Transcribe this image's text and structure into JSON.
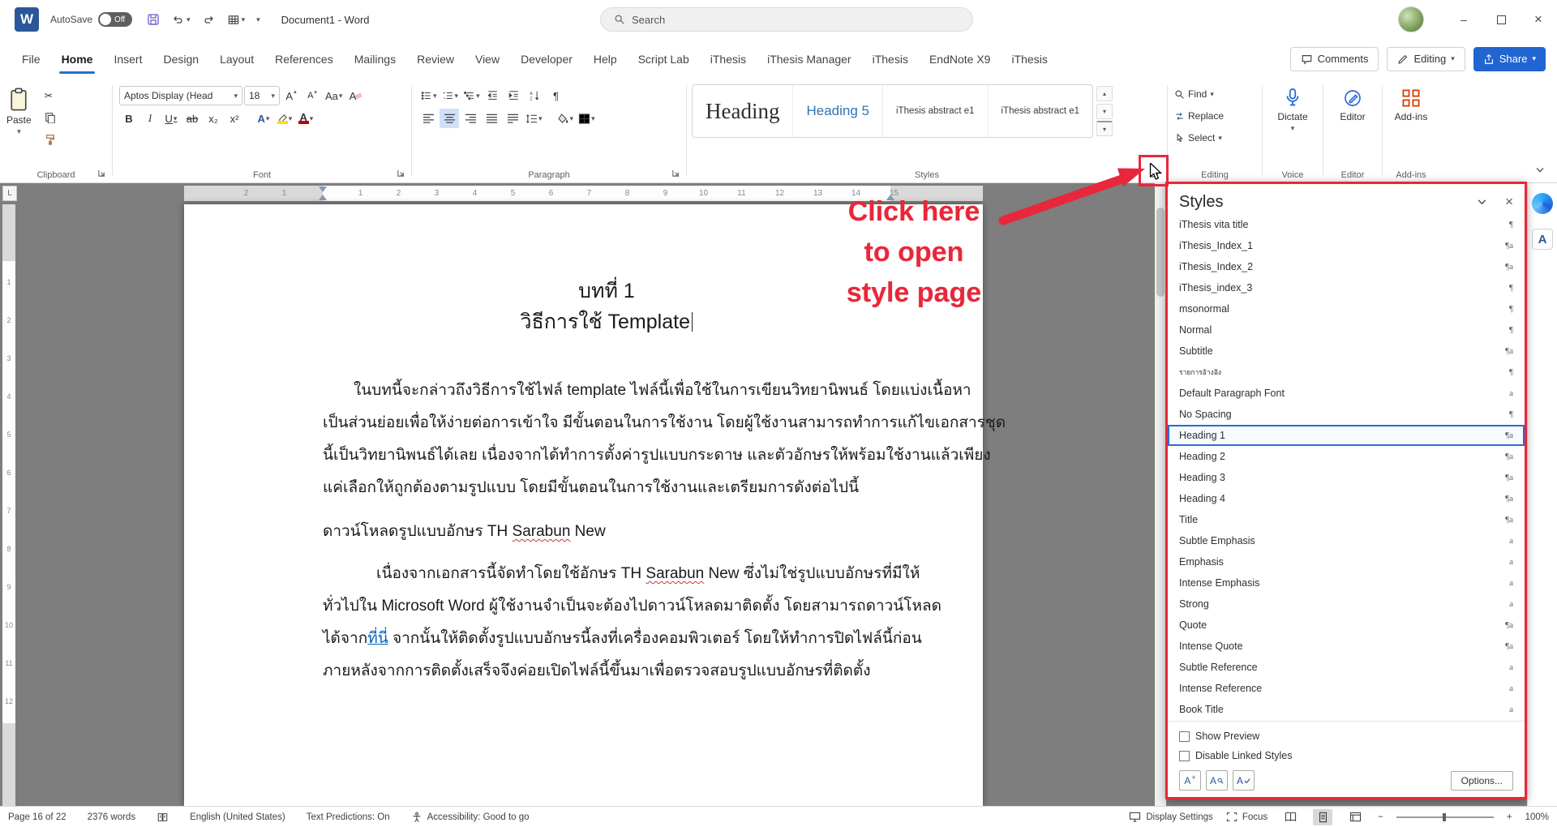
{
  "icons": {
    "chevron_down": "▾",
    "chevron_up": "▴",
    "pilcrow": "¶",
    "scissors": "✂",
    "close_x": "×",
    "minimize": "–",
    "bold": "B",
    "italic": "I",
    "underline": "U",
    "strike": "ab",
    "subscript": "x₂",
    "superscript": "x²",
    "case_aa": "Aa",
    "letter_a": "A",
    "plus": "+",
    "minus": "−",
    "ruler_tab": "L",
    "logo": "W"
  },
  "titlebar": {
    "logo": "W",
    "autosave_label": "AutoSave",
    "autosave_state": "Off",
    "doc_title": "Document1 - Word",
    "search_label": "Search"
  },
  "tabs": [
    "File",
    "Home",
    "Insert",
    "Design",
    "Layout",
    "References",
    "Mailings",
    "Review",
    "View",
    "Developer",
    "Help",
    "Script Lab",
    "iThesis",
    "iThesis Manager",
    "iThesis",
    "EndNote X9",
    "iThesis"
  ],
  "tab_actions": {
    "comments": "Comments",
    "editing": "Editing",
    "share": "Share"
  },
  "ribbon": {
    "font_name": "Aptos Display (Head",
    "font_size": "18",
    "paste": "Paste",
    "dictate": "Dictate",
    "editor": "Editor",
    "addins": "Add-ins",
    "find": "Find",
    "replace": "Replace",
    "select": "Select",
    "gallery": {
      "item1": "Heading",
      "item2": "Heading 5",
      "item3": "iThesis abstract e1",
      "item4": "iThesis abstract e1"
    },
    "labels": {
      "clipboard": "Clipboard",
      "font": "Font",
      "paragraph": "Paragraph",
      "styles": "Styles",
      "editing": "Editing",
      "voice": "Voice",
      "editor": "Editor",
      "addins": "Add-ins"
    }
  },
  "annotation": {
    "line1": "Click here",
    "line2": "to open",
    "line3": "style page"
  },
  "ruler": {
    "left_numbers": [
      "2",
      "1"
    ],
    "main_numbers": [
      "1",
      "2",
      "3",
      "4",
      "5",
      "6",
      "7",
      "8",
      "9",
      "10",
      "11",
      "12",
      "13",
      "14",
      "15"
    ],
    "v_numbers": [
      "1",
      "2",
      "3",
      "4",
      "5",
      "6",
      "7",
      "8",
      "9",
      "10",
      "11",
      "12"
    ]
  },
  "doc": {
    "h1": "บทที่ 1",
    "h2_thai": "วิธีการใช้ ",
    "h2_latin": "Template",
    "p1_l1": "ในบทนี้จะกล่าวถึงวิธีการใช้ไฟล์ template ไฟล์นี้เพื่อใช้ในการเขียนวิทยานิพนธ์ โดยแบ่งเนื้อหา",
    "p1_l2": "เป็นส่วนย่อยเพื่อให้ง่ายต่อการเข้าใจ มีขั้นตอนในการใช้งาน โดยผู้ใช้งานสามารถทำการแก้ไขเอกสารชุด",
    "p1_l3": "นี้เป็นวิทยานิพนธ์ได้เลย เนื่องจากได้ทำการตั้งค่ารูปแบบกระดาษ และตัวอักษรให้พร้อมใช้งานแล้วเพียง",
    "p1_l4": "แค่เลือกให้ถูกต้องตามรูปแบบ โดยมีขั้นตอนในการใช้งานและเตรียมการดังต่อไปนี้",
    "sub_a": "ดาวน์โหลดรูปแบบอักษร TH ",
    "sub_b": "Sarabun",
    "sub_c": " New",
    "p2_l1a": "เนื่องจากเอกสารนี้จัดทำโดยใช้อักษร TH ",
    "p2_l1b": "Sarabun",
    "p2_l1c": " New ซึ่งไม่ใช่รูปแบบอักษรที่มีให้",
    "p2_l2": "ทั่วไปใน Microsoft Word ผู้ใช้งานจำเป็นจะต้องไปดาวน์โหลดมาติดตั้ง โดยสามารถดาวน์โหลด",
    "p2_l3a": "ได้จาก",
    "p2_l3_link": "ที่นี่",
    "p2_l3b": " จากนั้นให้ติดตั้งรูปแบบอักษรนี้ลงที่เครื่องคอมพิวเตอร์ โดยให้ทำการปิดไฟล์นี้ก่อน",
    "p2_l4": "ภายหลังจากการติดตั้งเสร็จจึงค่อยเปิดไฟล์นี้ขึ้นมาเพื่อตรวจสอบรูปแบบอักษรที่ติดตั้ง"
  },
  "styles_pane": {
    "title": "Styles",
    "items": [
      {
        "name": "iThesis vita title",
        "mark": "¶"
      },
      {
        "name": "iThesis_Index_1",
        "mark": "¶a"
      },
      {
        "name": "iThesis_Index_2",
        "mark": "¶a"
      },
      {
        "name": "iThesis_index_3",
        "mark": "¶"
      },
      {
        "name": "msonormal",
        "mark": "¶"
      },
      {
        "name": "Normal",
        "mark": "¶"
      },
      {
        "name": "Subtitle",
        "mark": "¶a"
      },
      {
        "name": "รายการอ้างอิง",
        "mark": "¶"
      },
      {
        "name": "Default Paragraph Font",
        "mark": "a"
      },
      {
        "name": "No Spacing",
        "mark": "¶"
      },
      {
        "name": "Heading 1",
        "mark": "¶a"
      },
      {
        "name": "Heading 2",
        "mark": "¶a"
      },
      {
        "name": "Heading 3",
        "mark": "¶a"
      },
      {
        "name": "Heading 4",
        "mark": "¶a"
      },
      {
        "name": "Title",
        "mark": "¶a"
      },
      {
        "name": "Subtle Emphasis",
        "mark": "a"
      },
      {
        "name": "Emphasis",
        "mark": "a"
      },
      {
        "name": "Intense Emphasis",
        "mark": "a"
      },
      {
        "name": "Strong",
        "mark": "a"
      },
      {
        "name": "Quote",
        "mark": "¶a"
      },
      {
        "name": "Intense Quote",
        "mark": "¶a"
      },
      {
        "name": "Subtle Reference",
        "mark": "a"
      },
      {
        "name": "Intense Reference",
        "mark": "a"
      },
      {
        "name": "Book Title",
        "mark": "a"
      }
    ],
    "show_preview": "Show Preview",
    "disable_linked": "Disable Linked Styles",
    "options": "Options..."
  },
  "status": {
    "page": "Page 16 of 22",
    "words": "2376 words",
    "language": "English (United States)",
    "predictions": "Text Predictions: On",
    "accessibility": "Accessibility: Good to go",
    "display_settings": "Display Settings",
    "focus": "Focus",
    "zoom": "100%"
  },
  "colors": {
    "accent": "#2b579a",
    "annotation_red": "#e8273a",
    "share_blue": "#2065d1",
    "link_blue": "#0563c1"
  }
}
